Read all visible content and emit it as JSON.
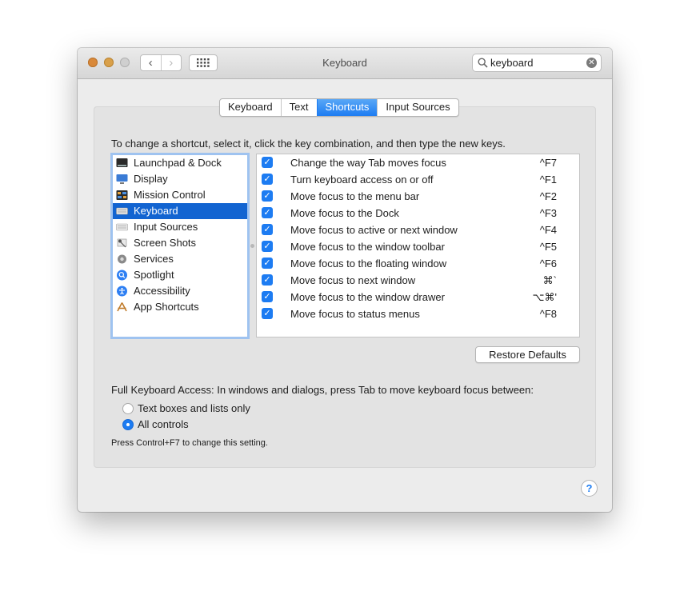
{
  "window": {
    "title": "Keyboard"
  },
  "toolbar": {
    "back_label": "‹",
    "forward_label": "›"
  },
  "search": {
    "value": "keyboard",
    "clear_label": "✕"
  },
  "tabs": [
    {
      "label": "Keyboard",
      "active": false
    },
    {
      "label": "Text",
      "active": false
    },
    {
      "label": "Shortcuts",
      "active": true
    },
    {
      "label": "Input Sources",
      "active": false
    }
  ],
  "instruction": "To change a shortcut, select it, click the key combination, and then type the new keys.",
  "categories": [
    {
      "label": "Launchpad & Dock",
      "icon": "launchpad-icon"
    },
    {
      "label": "Display",
      "icon": "display-icon"
    },
    {
      "label": "Mission Control",
      "icon": "mission-control-icon"
    },
    {
      "label": "Keyboard",
      "icon": "keyboard-icon",
      "selected": true
    },
    {
      "label": "Input Sources",
      "icon": "input-sources-icon"
    },
    {
      "label": "Screen Shots",
      "icon": "screenshot-icon"
    },
    {
      "label": "Services",
      "icon": "services-gear-icon"
    },
    {
      "label": "Spotlight",
      "icon": "spotlight-icon"
    },
    {
      "label": "Accessibility",
      "icon": "accessibility-icon"
    },
    {
      "label": "App Shortcuts",
      "icon": "app-shortcuts-icon"
    }
  ],
  "shortcuts": [
    {
      "checked": true,
      "label": "Change the way Tab moves focus",
      "key": "^F7"
    },
    {
      "checked": true,
      "label": "Turn keyboard access on or off",
      "key": "^F1"
    },
    {
      "checked": true,
      "label": "Move focus to the menu bar",
      "key": "^F2"
    },
    {
      "checked": true,
      "label": "Move focus to the Dock",
      "key": "^F3"
    },
    {
      "checked": true,
      "label": "Move focus to active or next window",
      "key": "^F4"
    },
    {
      "checked": true,
      "label": "Move focus to the window toolbar",
      "key": "^F5"
    },
    {
      "checked": true,
      "label": "Move focus to the floating window",
      "key": "^F6"
    },
    {
      "checked": true,
      "label": "Move focus to next window",
      "key": "⌘`"
    },
    {
      "checked": true,
      "label": "Move focus to the window drawer",
      "key": "⌥⌘'"
    },
    {
      "checked": true,
      "label": "Move focus to status menus",
      "key": "^F8"
    }
  ],
  "check_mark": "✓",
  "restore_defaults_label": "Restore Defaults",
  "full_keyboard_access": {
    "label": "Full Keyboard Access: In windows and dialogs, press Tab to move keyboard focus between:",
    "options": [
      {
        "label": "Text boxes and lists only",
        "selected": false
      },
      {
        "label": "All controls",
        "selected": true
      }
    ],
    "note": "Press Control+F7 to change this setting."
  },
  "help_label": "?",
  "colors": {
    "accent": "#1d7cf2",
    "selection": "#1264d1",
    "close": "#d9893a",
    "minimize": "#d9a04a"
  }
}
